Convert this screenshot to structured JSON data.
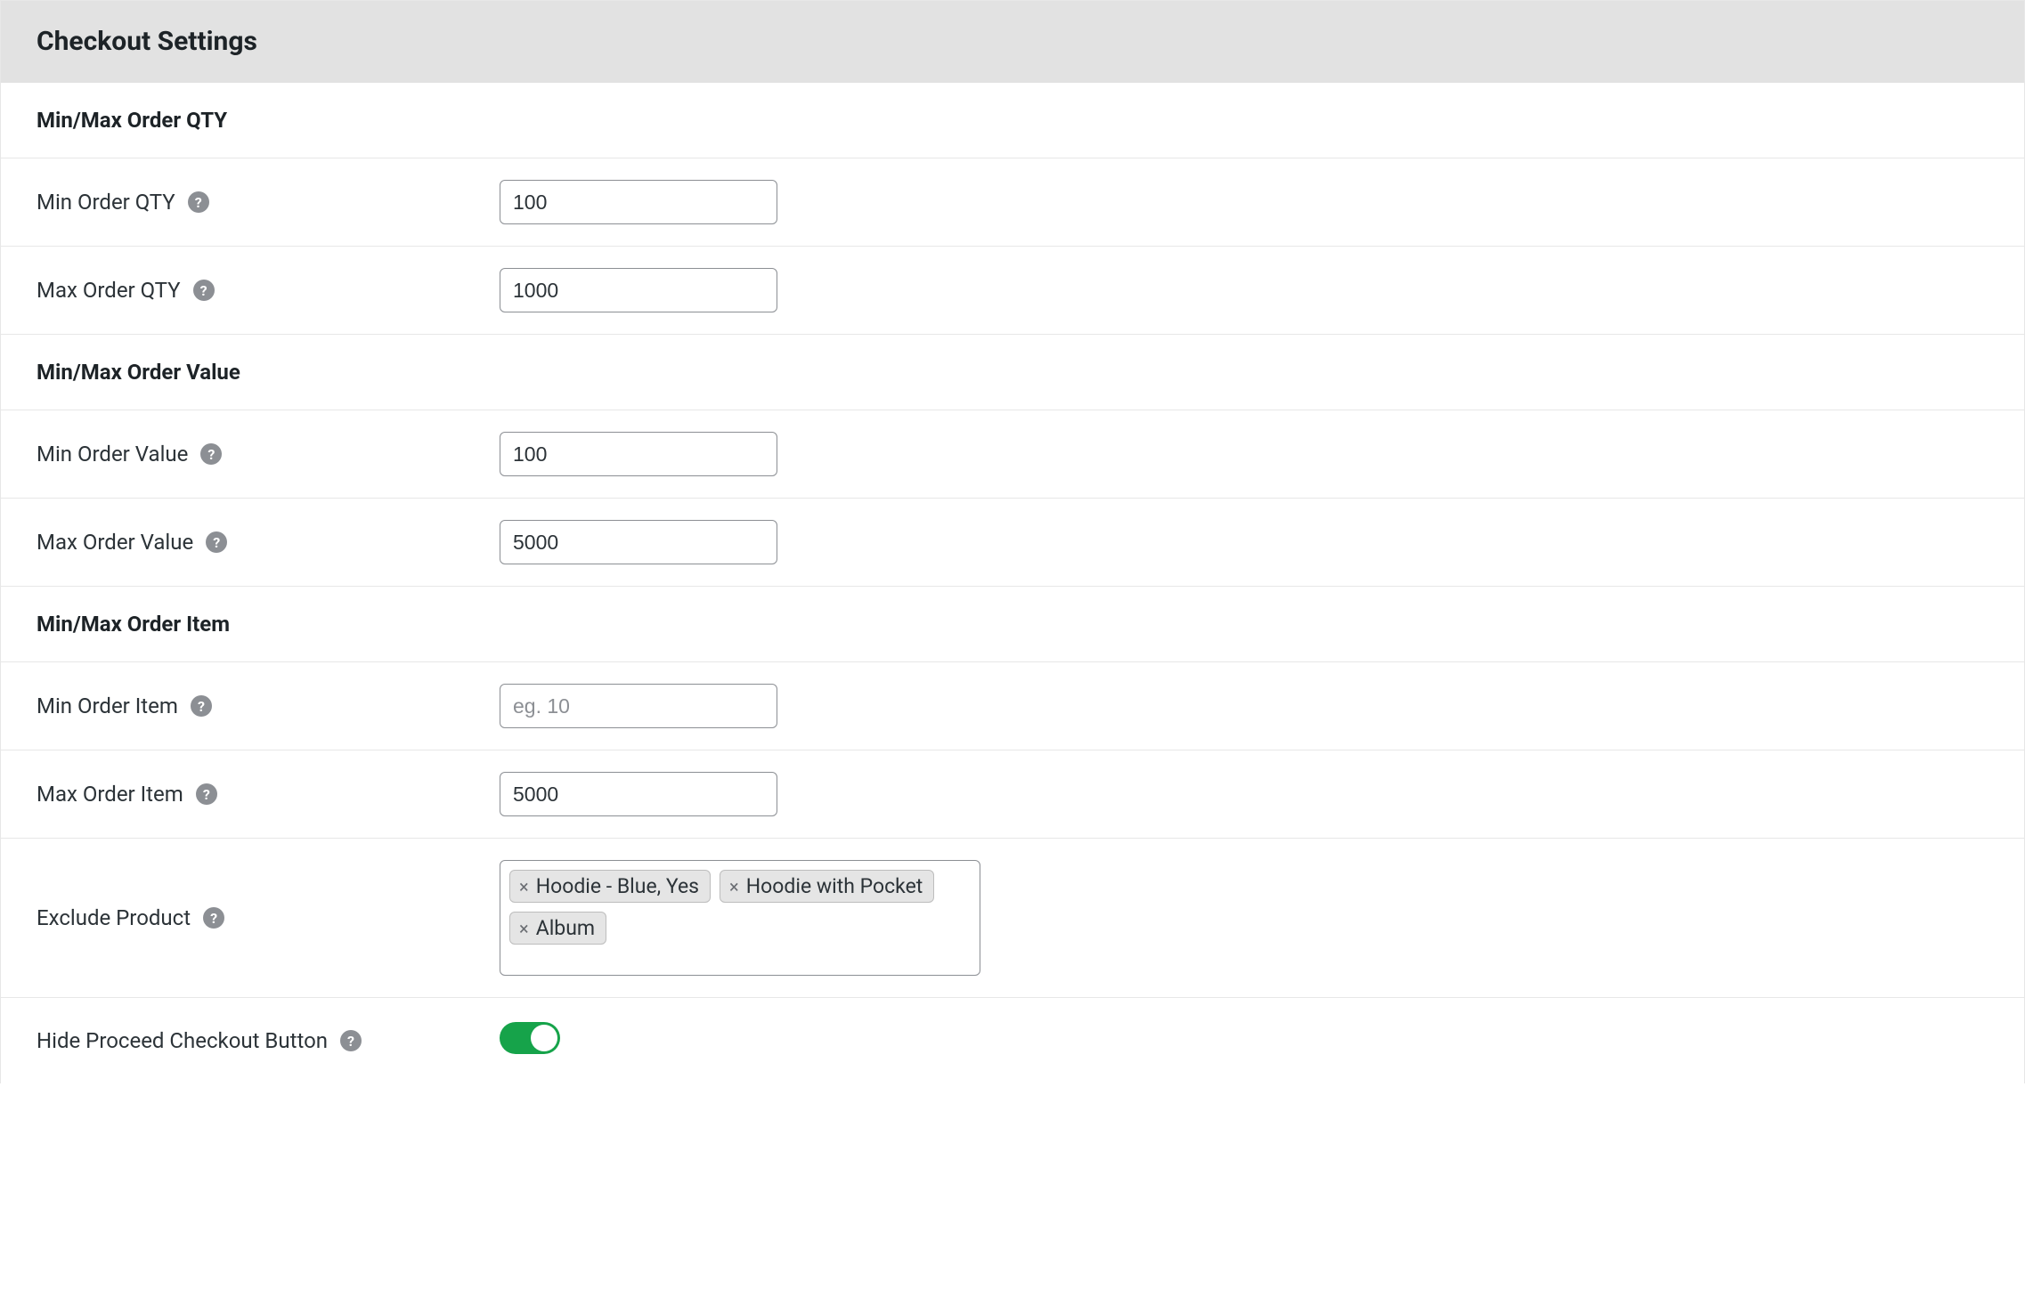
{
  "header": {
    "title": "Checkout Settings"
  },
  "sections": {
    "qty": {
      "heading": "Min/Max Order QTY",
      "min_label": "Min Order QTY",
      "min_value": "100",
      "max_label": "Max Order QTY",
      "max_value": "1000"
    },
    "value": {
      "heading": "Min/Max Order Value",
      "min_label": "Min Order Value",
      "min_value": "100",
      "max_label": "Max Order Value",
      "max_value": "5000"
    },
    "item": {
      "heading": "Min/Max Order Item",
      "min_label": "Min Order Item",
      "min_value": "",
      "min_placeholder": "eg. 10",
      "max_label": "Max Order Item",
      "max_value": "5000"
    },
    "exclude": {
      "label": "Exclude Product",
      "tags": [
        "Hoodie - Blue, Yes",
        "Hoodie with Pocket",
        "Album"
      ]
    },
    "hide_proceed": {
      "label": "Hide Proceed Checkout Button",
      "value": true
    }
  },
  "icons": {
    "help": "?"
  }
}
